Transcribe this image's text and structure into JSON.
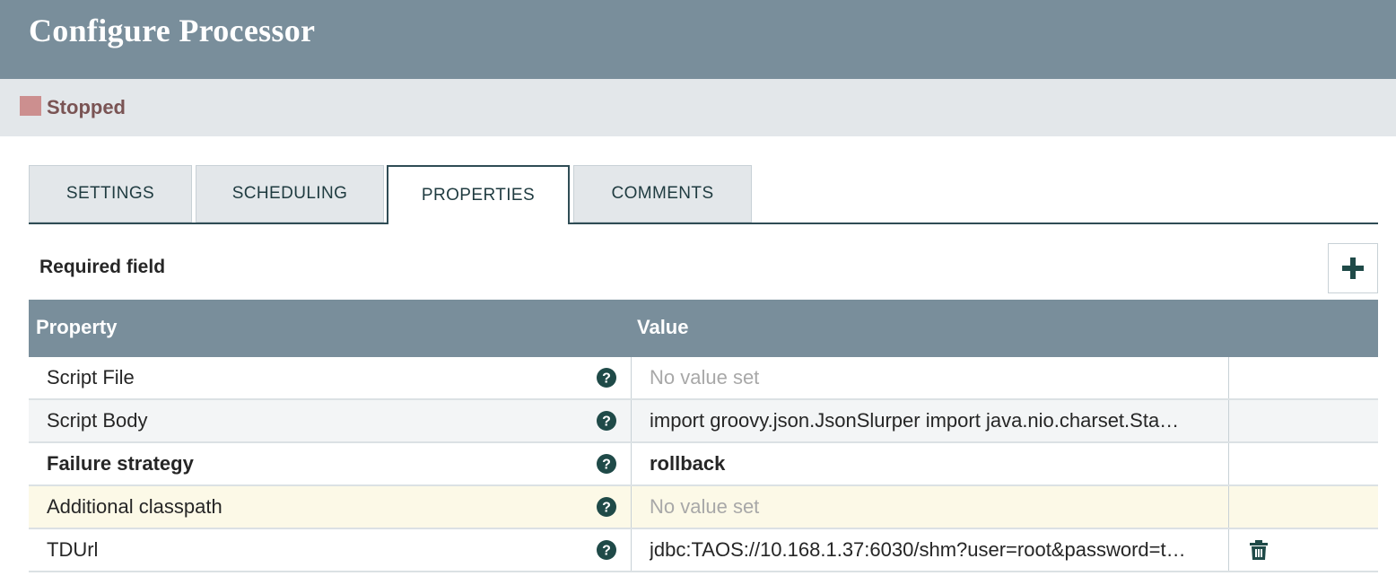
{
  "dialog": {
    "title": "Configure Processor"
  },
  "status": {
    "label": "Stopped",
    "color": "#cc8f8f"
  },
  "tabs": [
    {
      "label": "SETTINGS",
      "active": false
    },
    {
      "label": "SCHEDULING",
      "active": false
    },
    {
      "label": "PROPERTIES",
      "active": true
    },
    {
      "label": "COMMENTS",
      "active": false
    }
  ],
  "properties_panel": {
    "required_label": "Required field",
    "add_icon": "plus-icon",
    "columns": {
      "property": "Property",
      "value": "Value"
    },
    "rows": [
      {
        "name": "Script File",
        "value": "No value set",
        "value_is_placeholder": true,
        "required": false,
        "deletable": false
      },
      {
        "name": "Script Body",
        "value": "import groovy.json.JsonSlurper import java.nio.charset.Sta…",
        "value_is_placeholder": false,
        "required": false,
        "deletable": false
      },
      {
        "name": "Failure strategy",
        "value": "rollback",
        "value_is_placeholder": false,
        "required": true,
        "deletable": false
      },
      {
        "name": "Additional classpath",
        "value": "No value set",
        "value_is_placeholder": true,
        "required": false,
        "deletable": false
      },
      {
        "name": "TDUrl",
        "value": "jdbc:TAOS://10.168.1.37:6030/shm?user=root&password=t…",
        "value_is_placeholder": false,
        "required": false,
        "deletable": true
      }
    ]
  },
  "colors": {
    "header_bg": "#798e9b",
    "status_bar_bg": "#e3e7ea",
    "tab_border_active": "#2f4c55",
    "icon_dark": "#1f4a48",
    "highlight_row": "#fcf9e7"
  }
}
